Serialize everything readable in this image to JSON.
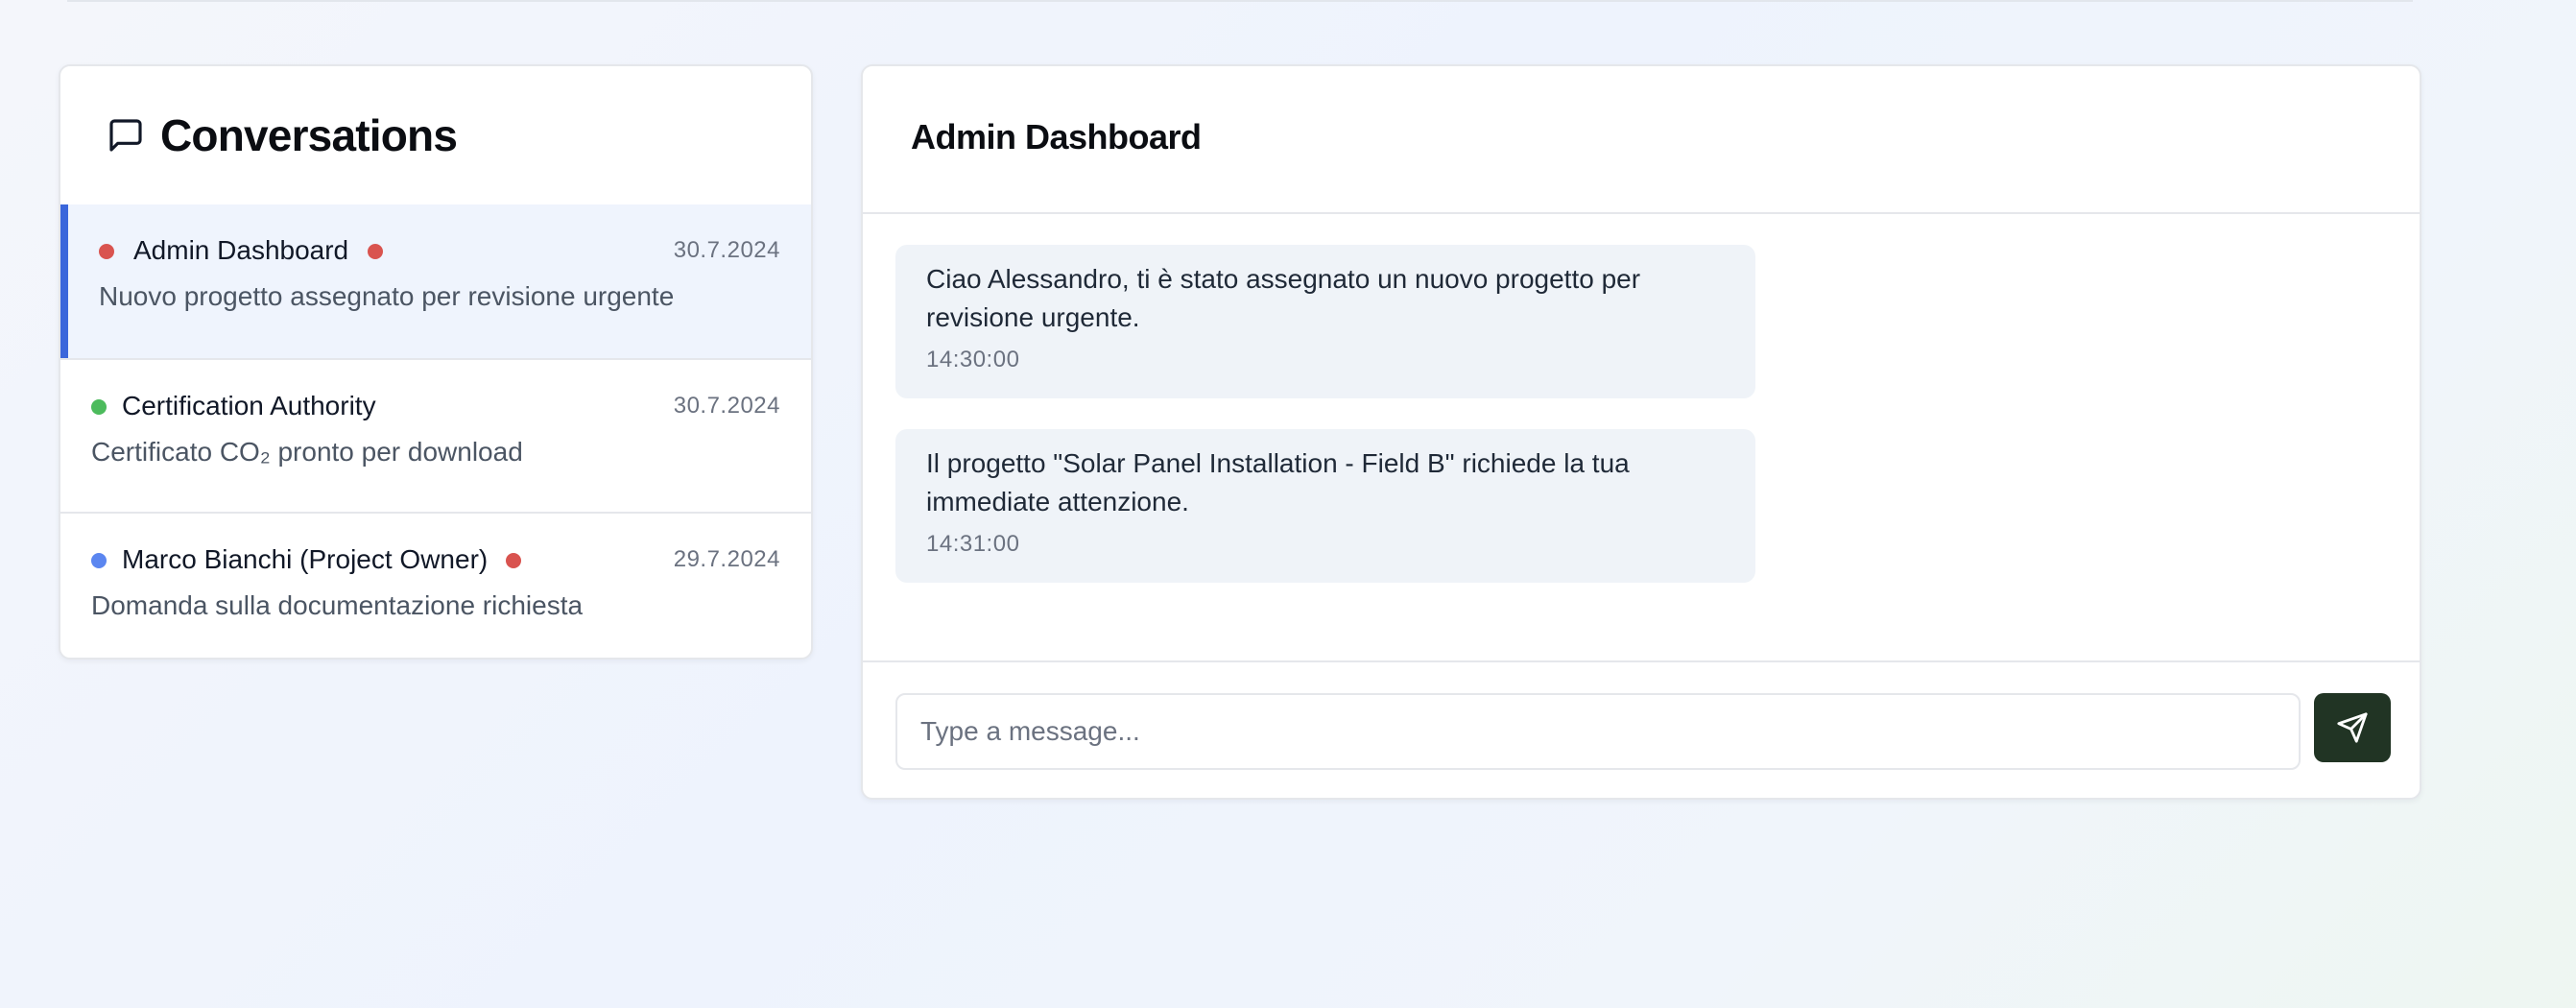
{
  "sidebar": {
    "title": "Conversations",
    "icon": "chat-bubble-icon",
    "conversations": [
      {
        "name": "Admin Dashboard",
        "date": "30.7.2024",
        "preview": "Nuovo progetto assegnato per revisione urgente",
        "status_color": "#d9534f",
        "unread": true,
        "active": true
      },
      {
        "name": "Certification Authority",
        "date": "30.7.2024",
        "preview": "Certificato CO₂ pronto per download",
        "status_color": "#4cbb5c",
        "unread": false,
        "active": false
      },
      {
        "name": "Marco Bianchi (Project Owner)",
        "date": "29.7.2024",
        "preview": "Domanda sulla documentazione richiesta",
        "status_color": "#5b86f0",
        "unread": true,
        "active": false
      }
    ]
  },
  "chat": {
    "title": "Admin Dashboard",
    "messages": [
      {
        "text": "Ciao Alessandro, ti è stato assegnato un nuovo progetto per revisione urgente.",
        "time": "14:30:00"
      },
      {
        "text": "Il progetto \"Solar Panel Installation - Field B\" richiede la tua immediate attenzione.",
        "time": "14:31:00"
      }
    ],
    "composer": {
      "placeholder": "Type a message...",
      "value": "",
      "send_icon": "send-icon"
    }
  },
  "colors": {
    "accent": "#3a66db",
    "active_background": "#eff4fd",
    "unread_indicator": "#d9534f",
    "send_button": "#213424",
    "message_bubble": "#eff3f8"
  }
}
